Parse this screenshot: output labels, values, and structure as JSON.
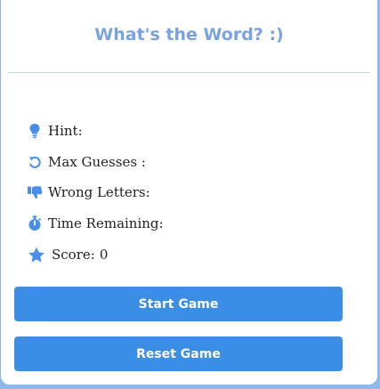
{
  "header": {
    "title": "What's the Word? :)"
  },
  "info": {
    "hint": {
      "label": "Hint:",
      "value": "",
      "icon": "lightbulb-icon"
    },
    "max_guesses": {
      "label": "Max Guesses :",
      "value": "",
      "icon": "undo-icon"
    },
    "wrong_letters": {
      "label": "Wrong Letters:",
      "value": "",
      "icon": "thumbs-down-icon"
    },
    "time_remaining": {
      "label": "Time Remaining:",
      "value": "",
      "icon": "stopwatch-icon"
    },
    "score": {
      "label": "Score:",
      "value": "0",
      "icon": "star-icon"
    }
  },
  "buttons": {
    "start_label": "Start Game",
    "reset_label": "Reset Game"
  },
  "colors": {
    "background": "#8eb8ea",
    "title": "#7aa2dd",
    "icon": "#4a8fe7",
    "button": "#3a8ee6"
  }
}
